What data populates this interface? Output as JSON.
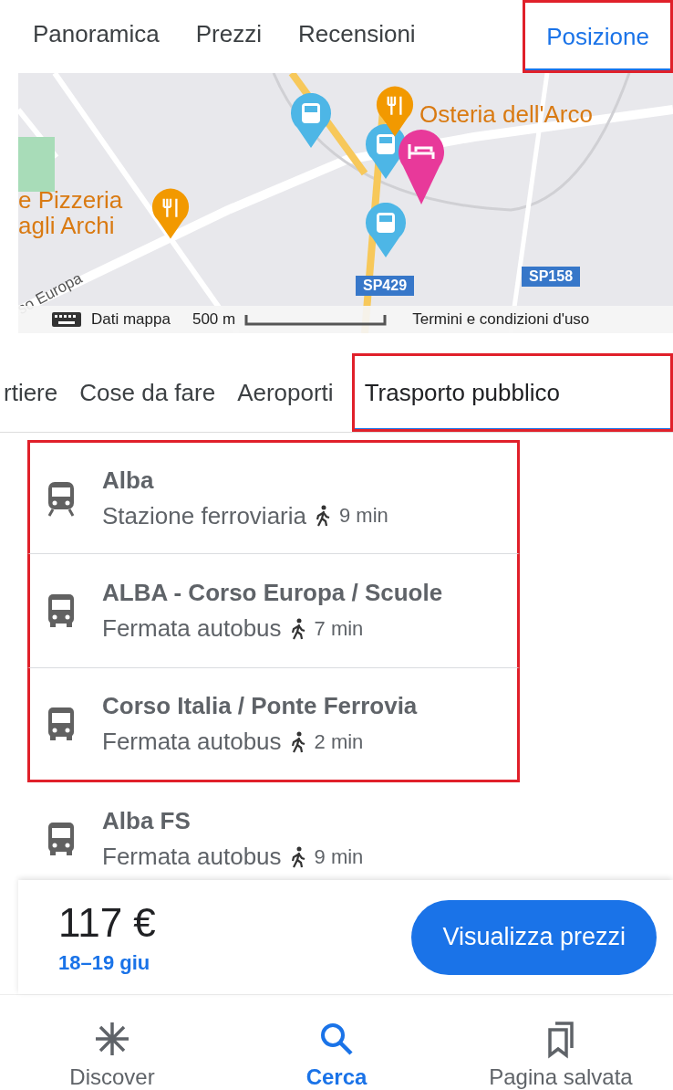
{
  "top_tabs": [
    {
      "label": "Panoramica",
      "selected": false,
      "highlighted": false
    },
    {
      "label": "Prezzi",
      "selected": false,
      "highlighted": false
    },
    {
      "label": "Recensioni",
      "selected": false,
      "highlighted": false
    },
    {
      "label": "Posizione",
      "selected": true,
      "highlighted": true
    }
  ],
  "map": {
    "labels": [
      {
        "text": "Osteria dell'Arco",
        "kind": "poi"
      },
      {
        "text": "e Pizzeria",
        "kind": "poi"
      },
      {
        "text": "agli Archi",
        "kind": "poi"
      },
      {
        "text": "so Europa",
        "kind": "street"
      },
      {
        "text": "SP158",
        "kind": "road"
      },
      {
        "text": "SP429",
        "kind": "road"
      }
    ],
    "attribution": "Dati mappa",
    "scale": "500 m",
    "terms": "Termini e condizioni d'uso"
  },
  "category_tabs": [
    {
      "label": "rtiere",
      "selected": false,
      "highlighted": false
    },
    {
      "label": "Cose da fare",
      "selected": false,
      "highlighted": false
    },
    {
      "label": "Aeroporti",
      "selected": false,
      "highlighted": false
    },
    {
      "label": "Trasporto pubblico",
      "selected": true,
      "highlighted": true
    }
  ],
  "places": [
    {
      "name": "Alba",
      "type": "Stazione ferroviaria",
      "kind": "train",
      "walk": "9 min",
      "highlighted": true
    },
    {
      "name": "ALBA - Corso Europa / Scuole",
      "type": "Fermata autobus",
      "kind": "bus",
      "walk": "7 min",
      "highlighted": true
    },
    {
      "name": "Corso Italia / Ponte Ferrovia",
      "type": "Fermata autobus",
      "kind": "bus",
      "walk": "2 min",
      "highlighted": true
    },
    {
      "name": "Alba FS",
      "type": "Fermata autobus",
      "kind": "bus",
      "walk": "9 min",
      "highlighted": false
    }
  ],
  "price": {
    "amount": "117 €",
    "dates": "18–19 giu",
    "button": "Visualizza prezzi"
  },
  "nav": [
    {
      "label": "Discover",
      "kind": "discover",
      "selected": false
    },
    {
      "label": "Cerca",
      "kind": "search",
      "selected": true
    },
    {
      "label": "Pagina salvata",
      "kind": "saved",
      "selected": false
    }
  ]
}
